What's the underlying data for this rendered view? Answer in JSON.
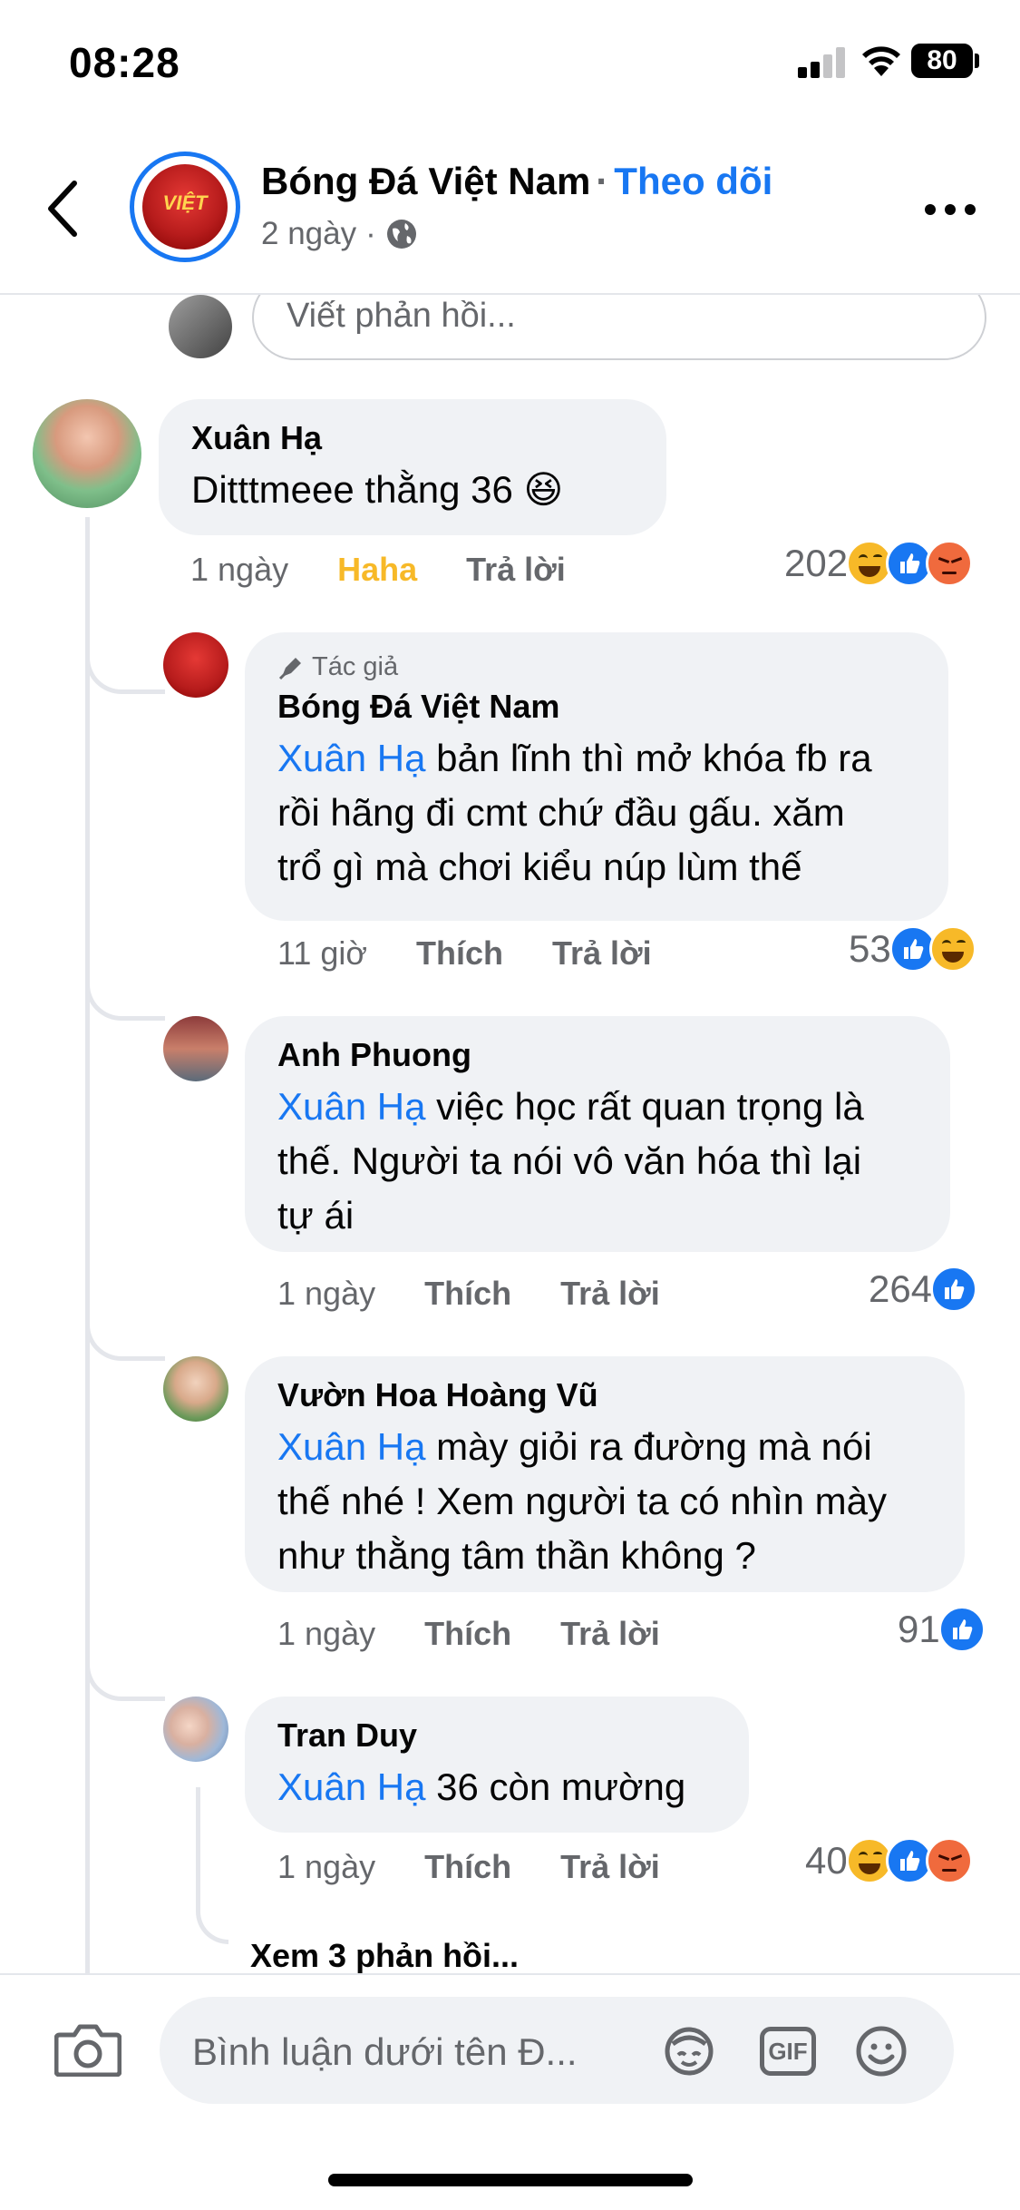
{
  "status_bar": {
    "time": "08:28",
    "battery": "80"
  },
  "header": {
    "page_name": "Bóng Đá Việt Nam",
    "separator": "·",
    "follow_label": "Theo dõi",
    "time_ago": "2 ngày",
    "dot": "·"
  },
  "reply_input": {
    "placeholder": "Viết phản hồi..."
  },
  "comments": [
    {
      "name": "Xuân Hạ",
      "text": "Ditttmeee thằng 36 😆",
      "time": "1 ngày",
      "like_label": "Haha",
      "reply_label": "Trả lời",
      "reaction_count": "202",
      "reactions": [
        "haha-icon",
        "like-icon",
        "angry-icon"
      ]
    }
  ],
  "replies": [
    {
      "author_tag": "Tác giả",
      "name": "Bóng Đá Việt Nam",
      "mention": "Xuân Hạ",
      "line1": " bản lĩnh thì mở khóa fb ra",
      "line2": "rồi hãng đi cmt chứ đầu gấu. xăm",
      "line3": "trổ gì mà chơi kiểu núp lùm thế",
      "time": "11 giờ",
      "like_label": "Thích",
      "reply_label": "Trả lời",
      "reaction_count": "53",
      "reactions": [
        "like-icon",
        "haha-icon"
      ]
    },
    {
      "name": "Anh Phuong",
      "mention": "Xuân Hạ",
      "line1": " việc học rất quan trọng là",
      "line2": "thế. Người ta nói vô văn hóa thì lại",
      "line3": "tự ái",
      "time": "1 ngày",
      "like_label": "Thích",
      "reply_label": "Trả lời",
      "reaction_count": "264",
      "reactions": [
        "like-icon"
      ]
    },
    {
      "name": "Vườn Hoa Hoàng Vũ",
      "mention": "Xuân Hạ",
      "line1": " mày giỏi ra đường mà nói",
      "line2": "thế nhé ! Xem người ta có nhìn mày",
      "line3": "như thằng tâm thần không ?",
      "time": "1 ngày",
      "like_label": "Thích",
      "reply_label": "Trả lời",
      "reaction_count": "91",
      "reactions": [
        "like-icon"
      ]
    },
    {
      "name": "Tran Duy",
      "mention": "Xuân Hạ",
      "line1": " 36 còn mường",
      "time": "1 ngày",
      "like_label": "Thích",
      "reply_label": "Trả lời",
      "reaction_count": "40",
      "reactions": [
        "haha-icon",
        "like-icon",
        "angry-icon"
      ]
    }
  ],
  "see_more_replies": "Xem 3 phản hồi...",
  "composer": {
    "placeholder": "Bình luận dưới tên Đ...",
    "icons": [
      "camera-icon",
      "avatar-sticker-icon",
      "gif-icon",
      "emoji-icon"
    ],
    "gif_label": "GIF"
  },
  "colors": {
    "accent": "#1877f2",
    "haha": "#f7b928",
    "angry": "#f06a3d",
    "bubble": "#f0f2f5"
  }
}
